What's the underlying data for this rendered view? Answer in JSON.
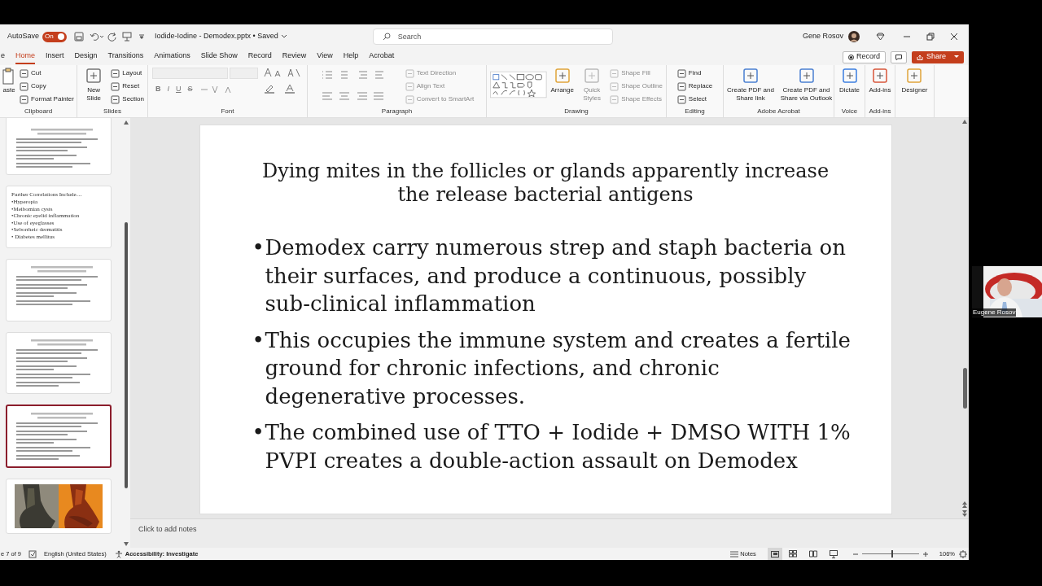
{
  "title_bar": {
    "autosave_label": "AutoSave",
    "autosave": {
      "on": true,
      "label": "On"
    },
    "file_title": "Iodide-Iodine - Demodex.pptx • Saved",
    "search_placeholder": "Search",
    "user_name": "Gene Rosov"
  },
  "ribbon_tabs": [
    {
      "label": "e",
      "selected": false
    },
    {
      "label": "Home",
      "selected": true
    },
    {
      "label": "Insert",
      "selected": false
    },
    {
      "label": "Design",
      "selected": false
    },
    {
      "label": "Transitions",
      "selected": false
    },
    {
      "label": "Animations",
      "selected": false
    },
    {
      "label": "Slide Show",
      "selected": false
    },
    {
      "label": "Record",
      "selected": false
    },
    {
      "label": "Review",
      "selected": false
    },
    {
      "label": "View",
      "selected": false
    },
    {
      "label": "Help",
      "selected": false
    },
    {
      "label": "Acrobat",
      "selected": false
    }
  ],
  "ribbon_actions": {
    "record": "Record",
    "share": "Share"
  },
  "ribbon_groups": [
    {
      "label": "Clipboard",
      "items": [
        {
          "kind": "paste",
          "label": "aste",
          "disabled": false
        },
        {
          "kind": "small",
          "label": "Cut",
          "disabled": false
        },
        {
          "kind": "small",
          "label": "Copy",
          "disabled": false
        },
        {
          "kind": "small",
          "label": "Format Painter",
          "disabled": false
        }
      ]
    },
    {
      "label": "Slides",
      "items": [
        {
          "kind": "large",
          "label": "New Slide",
          "disabled": false
        },
        {
          "kind": "small",
          "label": "Layout",
          "disabled": false
        },
        {
          "kind": "small",
          "label": "Reset",
          "disabled": false
        },
        {
          "kind": "small",
          "label": "Section",
          "disabled": false
        }
      ]
    },
    {
      "label": "Font",
      "items": [
        {
          "kind": "font",
          "label": "B",
          "disabled": false
        },
        {
          "kind": "font",
          "label": "I",
          "disabled": false
        },
        {
          "kind": "font",
          "label": "U",
          "disabled": false
        },
        {
          "kind": "font",
          "label": "S",
          "disabled": false
        }
      ]
    },
    {
      "label": "Paragraph",
      "items": [
        {
          "kind": "small",
          "label": "Text Direction",
          "disabled": true
        },
        {
          "kind": "small",
          "label": "Align Text",
          "disabled": true
        },
        {
          "kind": "small",
          "label": "Convert to SmartArt",
          "disabled": true
        }
      ]
    },
    {
      "label": "Drawing",
      "items": [
        {
          "kind": "large",
          "label": "Arrange",
          "disabled": false
        },
        {
          "kind": "large",
          "label": "Quick Styles",
          "disabled": true
        },
        {
          "kind": "small",
          "label": "Shape Fill",
          "disabled": true
        },
        {
          "kind": "small",
          "label": "Shape Outline",
          "disabled": true
        },
        {
          "kind": "small",
          "label": "Shape Effects",
          "disabled": true
        }
      ]
    },
    {
      "label": "Editing",
      "items": [
        {
          "kind": "small",
          "label": "Find",
          "disabled": false
        },
        {
          "kind": "small",
          "label": "Replace",
          "disabled": false
        },
        {
          "kind": "small",
          "label": "Select",
          "disabled": false
        }
      ]
    },
    {
      "label": "Adobe Acrobat",
      "items": [
        {
          "kind": "large",
          "label": "Create PDF and Share link",
          "disabled": false
        },
        {
          "kind": "large",
          "label": "Create PDF and Share via Outlook",
          "disabled": false
        }
      ]
    },
    {
      "label": "Voice",
      "items": [
        {
          "kind": "large",
          "label": "Dictate",
          "disabled": false
        }
      ]
    },
    {
      "label": "Add-ins",
      "items": [
        {
          "kind": "large",
          "label": "Add-ins",
          "disabled": false
        }
      ]
    },
    {
      "items": [
        {
          "kind": "large",
          "label": "Designer",
          "disabled": false
        }
      ]
    }
  ],
  "thumbnails": [
    {
      "kind": "miniature",
      "selected": false
    },
    {
      "kind": "text",
      "selected": false,
      "title": "Further Correlations Include…",
      "bullets": [
        "•Hyperopia",
        "•Meibomian cysts",
        "•Chronic eyelid inflammation",
        "•Use of eyeglasses",
        "•Seborrheic dermatitis",
        "• Diabetes mellitus"
      ]
    },
    {
      "kind": "miniature",
      "selected": false
    },
    {
      "kind": "miniature",
      "selected": false
    },
    {
      "kind": "miniature",
      "selected": true
    },
    {
      "kind": "picture",
      "selected": false
    }
  ],
  "slide": {
    "title": "Dying mites in the follicles or glands apparently increase the release bacterial antigens",
    "bullets": [
      {
        "mark": "•",
        "text": "Demodex carry numerous strep and staph bacteria on their surfaces, and produce a continuous, possibly sub-clinical inflammation"
      },
      {
        "mark": "•",
        "text": "This occupies the immune system and creates a fertile ground for chronic infections, and chronic degenerative processes."
      },
      {
        "mark": "•",
        "text": "The combined use of TTO  + Iodide + DMSO WITH 1% PVPI creates a double-action assault on Demodex"
      }
    ]
  },
  "notes_placeholder": "Click to add notes",
  "status_bar": {
    "slide_counter": "e 7 of 9",
    "language": "English (United States)",
    "accessibility": "Accessibility: Investigate",
    "notes": "Notes",
    "zoom": "106%",
    "zoom_slider": {
      "level": 0.53
    }
  },
  "video_tile": {
    "name": "Eugene Rosov"
  }
}
